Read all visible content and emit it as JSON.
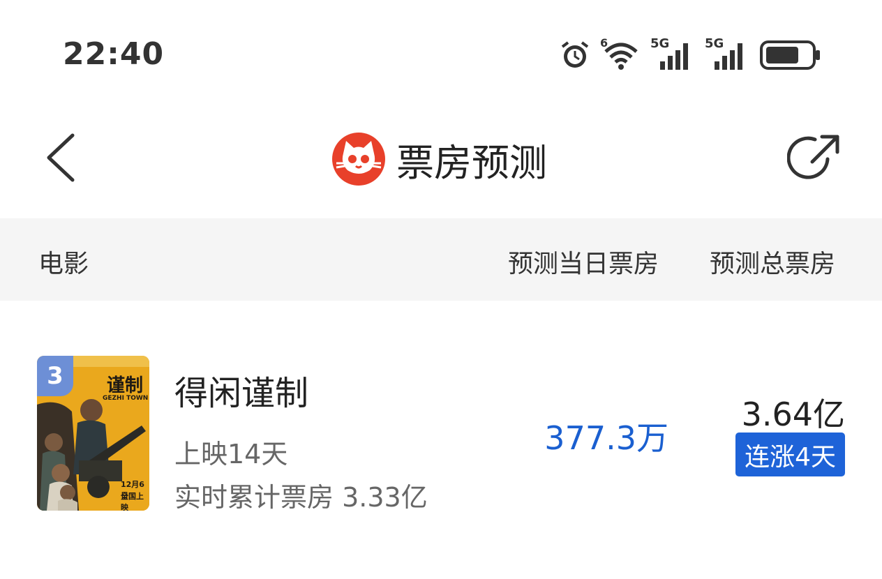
{
  "status_bar": {
    "time": "22:40",
    "icons": [
      "alarm-icon",
      "wifi-icon",
      "signal-5g-icon",
      "signal-5g-icon",
      "battery-icon"
    ],
    "wifi_badge": "6",
    "net1": "5G",
    "net2": "5G"
  },
  "nav": {
    "title": "票房预测",
    "back_icon": "chevron-left-icon",
    "logo": "maoyan-cat-logo",
    "share_icon": "share-icon"
  },
  "table": {
    "headers": {
      "movie": "电影",
      "daily": "预测当日票房",
      "total": "预测总票房"
    },
    "rows": [
      {
        "rank": "3",
        "title": "得闲谨制",
        "days_showing": "上映14天",
        "cumulative": "实时累计票房 3.33亿",
        "daily_forecast": "377.3万",
        "total_forecast": "3.64亿",
        "trend": "连涨4天",
        "poster": {
          "title_mark": "谨制",
          "subtitle_mark": "GEZHI TOWN",
          "date_mark": "12月6日",
          "release_mark": "全国上映"
        }
      }
    ]
  },
  "colors": {
    "accent_blue": "#1a5fd0",
    "trend_bg": "#1e63d8",
    "rank_badge": "#6d8fd6",
    "logo_red": "#e8402a",
    "header_bg": "#f5f5f5"
  }
}
